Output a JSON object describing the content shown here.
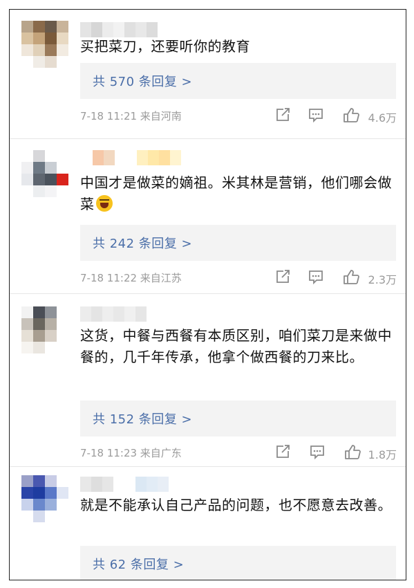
{
  "comments": [
    {
      "text": "买把菜刀，还要听你的教育",
      "replies": "共 570 条回复 >",
      "time": "7-18 11:21 来自河南",
      "likes": "4.6万",
      "avatar_colors": [
        "#b8a48a",
        "#8a6a4a",
        "#6a5a4a",
        "#c9b49a",
        "#d9c2a0",
        "#c4a37a",
        "#7a5a3a",
        "#e8d9c2",
        "#efe6da",
        "#e0d0b8",
        "#9a7a5a",
        "#f2ebe1",
        "#ffffff",
        "#f0ece6",
        "#e6dcd0",
        "#ffffff"
      ],
      "name_colors": [
        "#e4e4e4",
        "#d6d6d6",
        "#ececec",
        "#f2f2f2",
        "#e0e0e0",
        "#e8e8e8",
        "#dcdcdc"
      ]
    },
    {
      "text": "中国才是做菜的嫡祖。米其林是营销，他们哪会做菜",
      "replies": "共 242 条回复 >",
      "time": "7-18 11:22 来自江苏",
      "likes": "2.3万",
      "avatar_colors": [
        "#ffffff",
        "#d7d7da",
        "#ffffff",
        "#ffffff",
        "#f0f0f2",
        "#6f7a86",
        "#c9ced4",
        "#ffffff",
        "#e6e8ec",
        "#5e6670",
        "#4a525c",
        "#d9241c",
        "#ffffff",
        "#eceef0",
        "#f4f4f6",
        "#ffffff"
      ],
      "name_colors": [
        "#f6c8a8",
        "#f2d8c0",
        "#ffffff",
        "#ffffff",
        "#fff0c0",
        "#ffe8a8",
        "#ffe0a0",
        "#fff4d0"
      ]
    },
    {
      "text": "这货，中餐与西餐有本质区别，咱们菜刀是来做中餐的，几千年传承，他拿个做西餐的刀来比。",
      "replies": "共 152 条回复 >",
      "time": "7-18 11:23 来自广东",
      "likes": "1.8万",
      "avatar_colors": [
        "#f2f2f2",
        "#4a4e56",
        "#8e9298",
        "#ffffff",
        "#c8c2ba",
        "#6a665e",
        "#b7b0a6",
        "#ffffff",
        "#e6e0d6",
        "#a89e90",
        "#d8d0c6",
        "#ffffff",
        "#f6f4f0",
        "#eae6e0",
        "#ffffff",
        "#ffffff"
      ],
      "name_colors": [
        "#ececec",
        "#e4e4e4",
        "#eeeeee",
        "#e8e8e8",
        "#f0f0f0",
        "#e6e6e6"
      ]
    },
    {
      "text": "就是不能承认自己产品的问题，也不愿意去改善。",
      "replies": "共 62 条回复 >",
      "time": "",
      "likes": "",
      "avatar_colors": [
        "#9aa0c8",
        "#4a58b0",
        "#c8cce6",
        "#ffffff",
        "#2a44a8",
        "#1e3ca0",
        "#5a78c8",
        "#e0e6f4",
        "#c8d2ec",
        "#6a88cc",
        "#9ab0dc",
        "#ffffff",
        "#ffffff",
        "#d6dcee",
        "#ffffff",
        "#ffffff"
      ],
      "name_colors": [
        "#e8e8e8",
        "#dedede",
        "#e6e6e6",
        "#ffffff",
        "#ffffff",
        "#dbe8f4",
        "#e2ecf6",
        "#e8eef6"
      ]
    }
  ]
}
